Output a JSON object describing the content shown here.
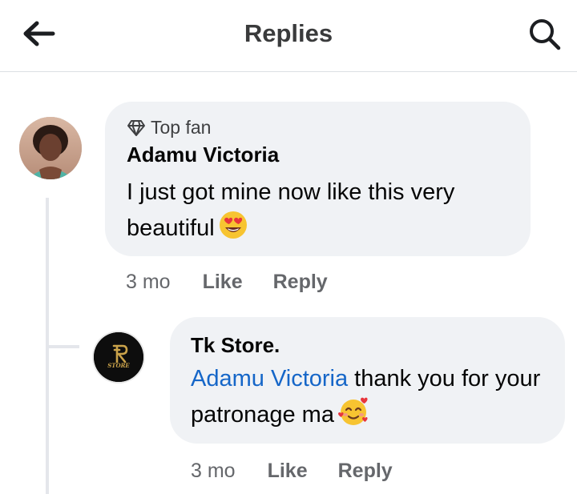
{
  "header": {
    "title": "Replies",
    "back_icon": "arrow-left-icon",
    "search_icon": "search-icon"
  },
  "comments": [
    {
      "badge_icon": "diamond-icon",
      "badge": "Top fan",
      "author": "Adamu Victoria",
      "text": "I just got mine now like this very beautiful",
      "emoji": "heart-eyes-emoji",
      "time": "3 mo",
      "like_label": "Like",
      "reply_label": "Reply"
    },
    {
      "author": "Tk Store.",
      "mention": "Adamu Victoria",
      "text": " thank you for your patronage ma",
      "emoji": "smiling-face-with-hearts-emoji",
      "avatar_text": "STORE",
      "time": "3 mo",
      "like_label": "Like",
      "reply_label": "Reply"
    }
  ],
  "colors": {
    "mention": "#1566c8",
    "bubble": "#f0f2f5",
    "secondary_text": "#65676b"
  }
}
